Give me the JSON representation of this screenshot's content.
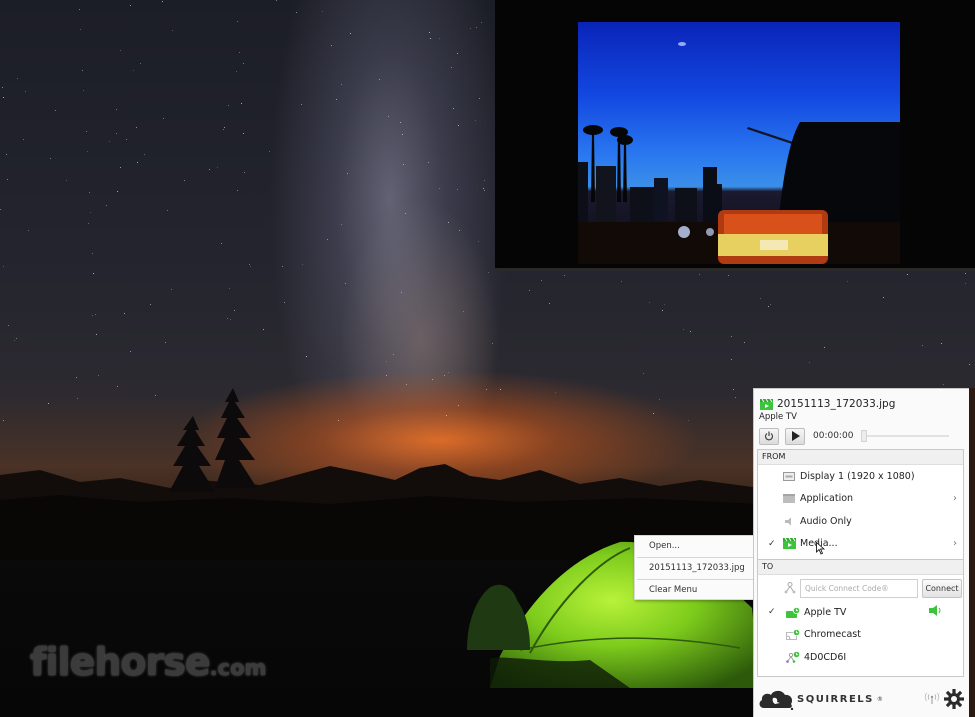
{
  "desktop": {
    "watermark": {
      "name": "filehorse",
      "suffix": ".com"
    }
  },
  "preview_window": {
    "content": "night city street photo preview"
  },
  "context_menu": {
    "items": [
      {
        "label": "Open..."
      },
      {
        "label": "20151113_172033.jpg"
      },
      {
        "label": "Clear Menu"
      }
    ]
  },
  "panel": {
    "file_title": "20151113_172033.jpg",
    "file_icon": "media-clapper-icon",
    "device": "Apple TV",
    "controls": {
      "power_icon": "power-icon",
      "play_icon": "play-icon",
      "time": "00:00:00",
      "progress": 0
    },
    "from": {
      "header": "FROM",
      "items": [
        {
          "label": "Display 1 (1920 x 1080)",
          "icon": "display-icon",
          "checked": false,
          "submenu": false
        },
        {
          "label": "Application",
          "icon": "application-icon",
          "checked": false,
          "submenu": true
        },
        {
          "label": "Audio Only",
          "icon": "speaker-icon",
          "checked": false,
          "submenu": false
        },
        {
          "label": "Media...",
          "icon": "media-clapper-icon",
          "checked": true,
          "submenu": true
        }
      ]
    },
    "to": {
      "header": "TO",
      "quick_connect": {
        "placeholder": "Quick Connect Code®",
        "value": "",
        "button": "Connect"
      },
      "devices": [
        {
          "label": "Apple TV",
          "icon": "apple-tv-icon",
          "checked": true,
          "volume_icon": "volume-icon"
        },
        {
          "label": "Chromecast",
          "icon": "chromecast-icon",
          "checked": false
        },
        {
          "label": "4D0CD6I",
          "icon": "network-device-icon",
          "checked": false
        }
      ]
    },
    "footer": {
      "brand": "SQUIRRELS",
      "brand_mark": "®",
      "signal_icon": "broadcast-icon",
      "settings_icon": "gear-icon"
    },
    "colors": {
      "accent_green": "#3cc43c",
      "panel_bg": "#fafafa",
      "section_header_bg": "#f0f0f0"
    }
  }
}
